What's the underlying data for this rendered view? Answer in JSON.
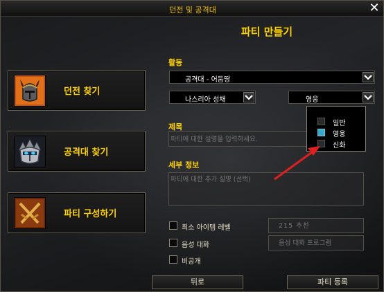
{
  "window": {
    "title": "던전 및 공격대"
  },
  "header": {
    "title": "파티 만들기"
  },
  "left_menu": [
    {
      "label": "던전 찾기"
    },
    {
      "label": "공격대 찾기"
    },
    {
      "label": "파티 구성하기"
    }
  ],
  "activity": {
    "label": "활동",
    "category": "공격대 - 어둠땅",
    "raid": "나스리아 성채",
    "difficulty": "영웅"
  },
  "difficulty_popup": {
    "options": [
      {
        "label": "일반",
        "selected": false
      },
      {
        "label": "영웅",
        "selected": true
      },
      {
        "label": "신화",
        "selected": false
      }
    ],
    "highlight_color": "#3aa6c8"
  },
  "title_field": {
    "label": "제목",
    "placeholder": "파티에 대한 설명을 입력하세요."
  },
  "details_field": {
    "label": "세부 정보",
    "placeholder": "파티에 대한 추가 설명 (선택)"
  },
  "options": {
    "min_item_level": {
      "label": "최소 아이템 레벨",
      "placeholder": "215 추천"
    },
    "voice_chat": {
      "label": "음성 대화",
      "placeholder": "음성 대화 프로그램"
    },
    "private": {
      "label": "비공개"
    }
  },
  "buttons": {
    "back": "뒤로",
    "register": "파티 등록"
  },
  "colors": {
    "gold": "#ffd200",
    "annotation_arrow": "#e02020"
  }
}
